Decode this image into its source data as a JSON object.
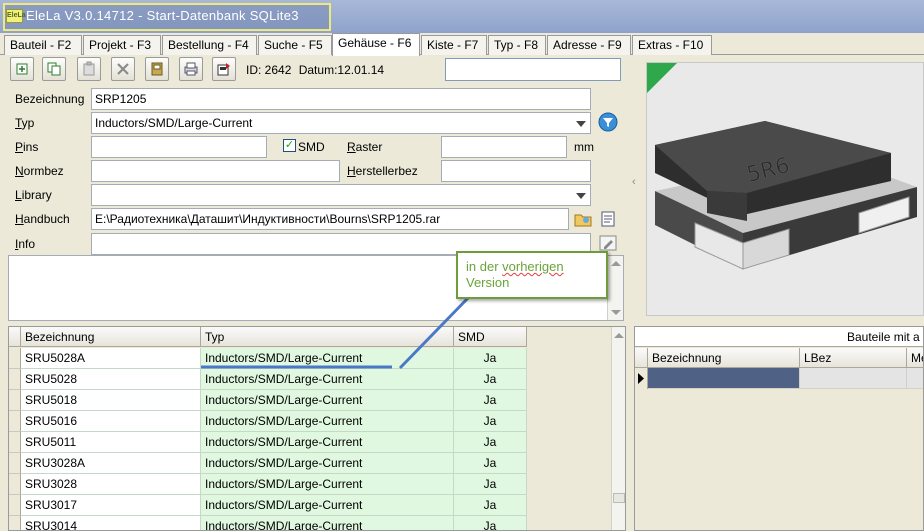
{
  "window": {
    "title": "EleLa V3.0.14712  - Start-Datenbank SQLite3",
    "logo_text": "EleLa"
  },
  "tabs": [
    {
      "label": "Bauteil - F2"
    },
    {
      "label": "Projekt - F3"
    },
    {
      "label": "Bestellung - F4"
    },
    {
      "label": "Suche - F5"
    },
    {
      "label": "Gehäuse - F6",
      "active": true
    },
    {
      "label": "Kiste - F7"
    },
    {
      "label": "Typ - F8"
    },
    {
      "label": "Adresse - F9"
    },
    {
      "label": "Extras - F10"
    }
  ],
  "toolbar": {
    "id_label": "ID: 2642",
    "date_label": "Datum:12.01.14"
  },
  "form": {
    "bezeichnung_label": "Bezeichnung",
    "bezeichnung_value": "SRP1205",
    "typ_label_first": "T",
    "typ_label_rest": "yp",
    "typ_value": "Inductors/SMD/Large-Current",
    "pins_label_first": "P",
    "pins_label_rest": "ins",
    "pins_value": "",
    "smd_label": "SMD",
    "smd_checked": true,
    "raster_label_first": "R",
    "raster_label_rest": "aster",
    "raster_value": "",
    "raster_unit": "mm",
    "normbez_label_first": "N",
    "normbez_label_rest": "ormbez",
    "normbez_value": "",
    "herstellerbez_label_first": "H",
    "herstellerbez_label_rest": "erstellerbez",
    "herstellerbez_value": "",
    "library_label_first": "L",
    "library_label_rest": "ibrary",
    "library_value": "",
    "handbuch_label_first": "H",
    "handbuch_label_rest": "andbuch",
    "handbuch_value": "E:\\Радиотехника\\Даташит\\Индуктивности\\Bourns\\SRP1205.rar",
    "info_label_first": "I",
    "info_label_rest": "nfo",
    "info_value": "",
    "memo_value": ""
  },
  "callout": {
    "line1_a": "in der ",
    "line1_b": "vorherigen",
    "line2": "Version"
  },
  "image": {
    "marking": "5R6"
  },
  "grid": {
    "columns": [
      "Bezeichnung",
      "Typ",
      "SMD"
    ],
    "rows": [
      {
        "bezeichnung": "SRU5028A",
        "typ": "Inductors/SMD/Large-Current",
        "smd": "Ja"
      },
      {
        "bezeichnung": "SRU5028",
        "typ": "Inductors/SMD/Large-Current",
        "smd": "Ja"
      },
      {
        "bezeichnung": "SRU5018",
        "typ": "Inductors/SMD/Large-Current",
        "smd": "Ja"
      },
      {
        "bezeichnung": "SRU5016",
        "typ": "Inductors/SMD/Large-Current",
        "smd": "Ja"
      },
      {
        "bezeichnung": "SRU5011",
        "typ": "Inductors/SMD/Large-Current",
        "smd": "Ja"
      },
      {
        "bezeichnung": "SRU3028A",
        "typ": "Inductors/SMD/Large-Current",
        "smd": "Ja"
      },
      {
        "bezeichnung": "SRU3028",
        "typ": "Inductors/SMD/Large-Current",
        "smd": "Ja"
      },
      {
        "bezeichnung": "SRU3017",
        "typ": "Inductors/SMD/Large-Current",
        "smd": "Ja"
      },
      {
        "bezeichnung": "SRU3014",
        "typ": "Inductors/SMD/Large-Current",
        "smd": "Ja"
      }
    ]
  },
  "right_grid": {
    "title": "Bauteile mit a",
    "columns": [
      "Bezeichnung",
      "LBez",
      "Me"
    ]
  },
  "colors": {
    "title_highlight": "#f0e87a",
    "callout_border": "#6e9c3c",
    "callout_text": "#6aa33a",
    "typ_column_bg": "#e0f8e0",
    "selected_cell": "#4f6184",
    "annotation_line": "#4a78c8"
  }
}
